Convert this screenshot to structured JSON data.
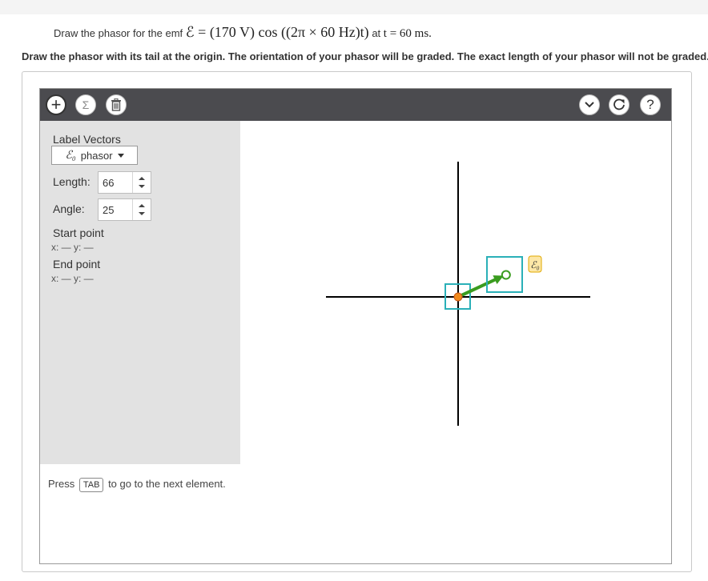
{
  "problem": {
    "prefix": "Draw the phasor for the emf",
    "emf_expression": "ℰ = (170 V) cos ((2π × 60 Hz)t)",
    "at_text": "at",
    "time_expression": "t = 60 ms."
  },
  "instructions": "Draw the phasor with its tail at the origin. The orientation of your phasor will be graded. The exact length of your phasor will not be graded.",
  "toolbar": {
    "add_icon": "plus-icon",
    "sum_icon": "sigma-icon",
    "sum_symbol": "Σ",
    "delete_icon": "trash-icon",
    "expand_icon": "chevron-down-icon",
    "reset_icon": "reset-icon",
    "help_icon": "help-icon",
    "help_symbol": "?"
  },
  "panel": {
    "label_vectors": "Label Vectors",
    "vector_select": {
      "symbol": "ℰ₀",
      "label": "phasor"
    },
    "length_label": "Length:",
    "length_value": "66",
    "angle_label": "Angle:",
    "angle_value": "25",
    "start_point_label": "Start point",
    "start_point_coords": "x: — y: —",
    "end_point_label": "End point",
    "end_point_coords": "x: — y: —"
  },
  "tab_hint": {
    "prefix": "Press",
    "key": "TAB",
    "suffix": "to go to the next element."
  },
  "graph": {
    "vector_label": "ℰ₀",
    "vector_length": 66,
    "vector_angle_deg": 25,
    "vector_color": "#3a9c1f",
    "handle_color": "#2ab0b8",
    "tail_color": "#f08a1c",
    "label_bg": "#fde7a6"
  }
}
